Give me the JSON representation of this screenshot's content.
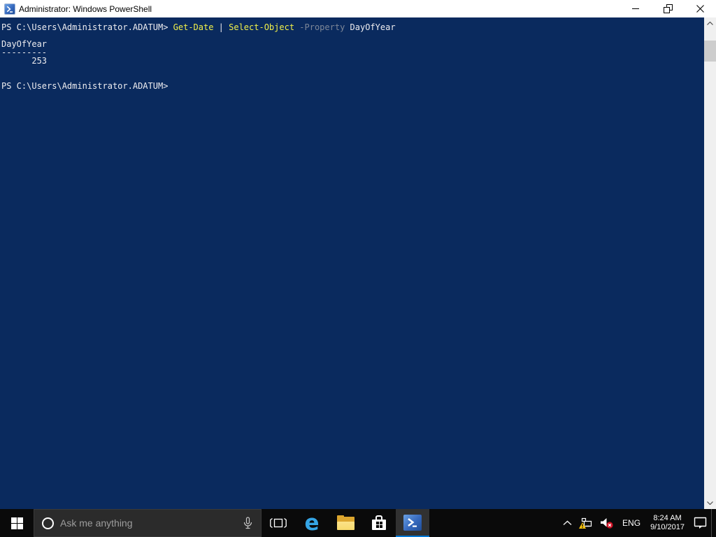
{
  "colors": {
    "console-bg": "#0a2a5e",
    "console-text": "#eeedf0",
    "console-command": "#f0f04a",
    "console-param": "#7d8798",
    "taskbar-bg": "#0a0a0a",
    "accent": "#0078d7",
    "titlebar-bg": "#ffffff",
    "titlebar-text": "#000000",
    "search-box-bg": "#2b2b2b",
    "search-placeholder": "#9d9d9d",
    "scrollbar-track": "#f0f0f0",
    "scrollbar-thumb": "#cdcdcd",
    "folder-front": "#f7d96b",
    "folder-back": "#dca62e",
    "edge-blue": "#35a5e5",
    "warning-yellow": "#fdc50b",
    "error-red": "#cf1124"
  },
  "window": {
    "title": "Administrator: Windows PowerShell"
  },
  "console": {
    "command_line": {
      "prompt": "PS C:\\Users\\Administrator.ADATUM> ",
      "cmdlet1": "Get-Date",
      "pipe": " | ",
      "cmdlet2": "Select-Object",
      "parameter": " -Property",
      "argument": " DayOfYear"
    },
    "output": {
      "header": "DayOfYear",
      "underline": "---------",
      "value": "      253"
    },
    "next_prompt": "PS C:\\Users\\Administrator.ADATUM>"
  },
  "taskbar": {
    "search": {
      "placeholder": "Ask me anything"
    },
    "app_buttons": [
      "start",
      "task-view",
      "microsoft-edge",
      "file-explorer",
      "microsoft-store",
      "windows-powershell"
    ],
    "active_app": "windows-powershell",
    "tray": {
      "language": "ENG",
      "time": "8:24 AM",
      "date": "9/10/2017"
    }
  },
  "icons": {
    "powershell-icon": ">_ on blue rounded square",
    "minimize-icon": "horizontal bar",
    "restore-icon": "two overlapping squares",
    "close-icon": "x cross",
    "scroll-up-icon": "chevron up",
    "scroll-down-icon": "chevron down",
    "start-icon": "windows four-pane logo",
    "cortana-icon": "white ring circle",
    "microphone-icon": "mic outline",
    "task-view-icon": "rectangle with side brackets",
    "edge-icon": "blue letter e",
    "file-explorer-icon": "yellow folder",
    "store-icon": "white shopping bag with windows logo",
    "tray-chevron-icon": "chevron up (hidden icons)",
    "network-warning-icon": "pc with yellow warning triangle",
    "volume-muted-icon": "speaker with red x badge",
    "action-center-icon": "speech bubble outline"
  }
}
